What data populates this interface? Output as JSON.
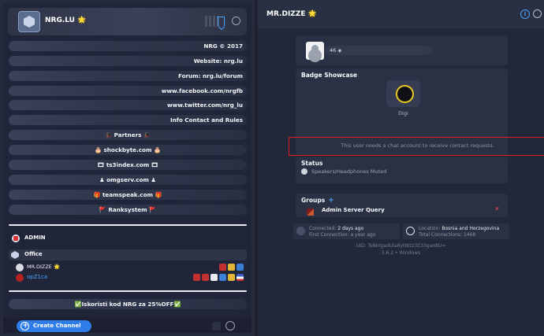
{
  "left": {
    "server_name": "NRG.LU 🌟",
    "rows": [
      {
        "text": "NRG © 2017",
        "align": "right"
      },
      {
        "text": "Website: nrg.lu",
        "align": "right"
      },
      {
        "text": "Forum: nrg.lu/forum",
        "align": "right"
      },
      {
        "text": "www.facebook.com/nrgfb",
        "align": "right"
      },
      {
        "text": "www.twitter.com/nrg_lu",
        "align": "right"
      },
      {
        "text": "Info Contact and Rules",
        "align": "right"
      },
      {
        "text": "🎩 Partners 🎩",
        "align": "center"
      },
      {
        "text": "🎂 shockbyte.com 🎂",
        "align": "center"
      },
      {
        "text": "🎞 ts3index.com 🎞",
        "align": "center"
      },
      {
        "text": "♟ omgserv.com ♟",
        "align": "center"
      },
      {
        "text": "🎁 teamspeak.com 🎁",
        "align": "center"
      },
      {
        "text": "🚩 Ranksystem 🚩",
        "align": "center"
      }
    ],
    "admin_label": "ADMIN",
    "office_label": "Office",
    "users": [
      {
        "name": "MR.DIZZE 🌟"
      },
      {
        "name": "opZ1ca"
      }
    ],
    "promo": "✅Iskoristi kod NRG za 25%OFF✅",
    "create_channel": "Create Channel"
  },
  "right": {
    "title": "MR.DIZZE 🌟",
    "info_icon_glyph": "i",
    "profile_value": "46 ◈",
    "badge_showcase_title": "Badge Showcase",
    "badge_name": "Digi",
    "contact_message": "This user needs a chat account to receive contact requests.",
    "status_title": "Status",
    "status_value": "Speakers/Headphones Muted",
    "groups_title": "Groups",
    "groups_add": "+",
    "group_name": "Admin Server Query",
    "group_remove": "✕",
    "connected_label": "Connected:",
    "connected_value": "2 days ago",
    "first_conn_label": "First Connection:",
    "first_conn_value": "a year ago",
    "location_label": "Location:",
    "location_value": "Bosnia and Herzegovina",
    "total_conn_label": "Total Connections:",
    "total_conn_value": "1468",
    "uid": "UID: TsNktgadUla8ytWzz3E33gao8U=",
    "version": "3.6.2 • Windows"
  }
}
